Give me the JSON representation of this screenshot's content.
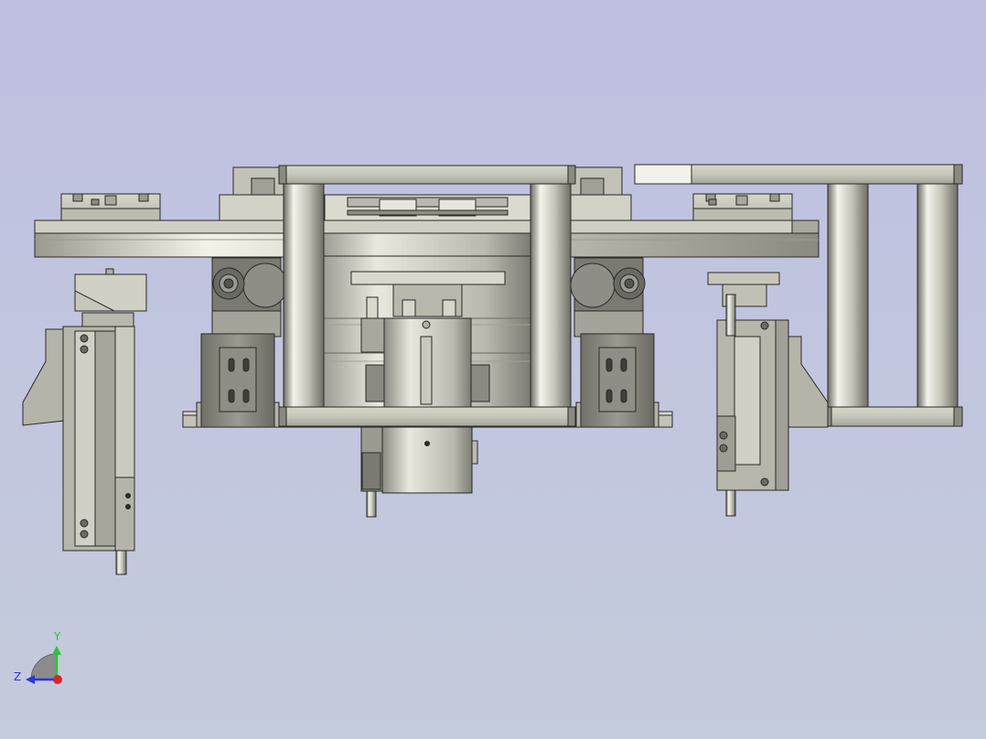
{
  "triad": {
    "y_label": "Y",
    "z_label": "Z",
    "y_color": "#2fbf3a",
    "z_color": "#2a35d8",
    "x_color": "#e0202a"
  },
  "colors": {
    "background_top": "#bfc0e0",
    "background_bottom": "#c4cbdb",
    "metal_light": "#e4e4d8",
    "metal_mid": "#c8c8bc",
    "metal_dark": "#8a8a80",
    "outline": "#2a2a28"
  }
}
